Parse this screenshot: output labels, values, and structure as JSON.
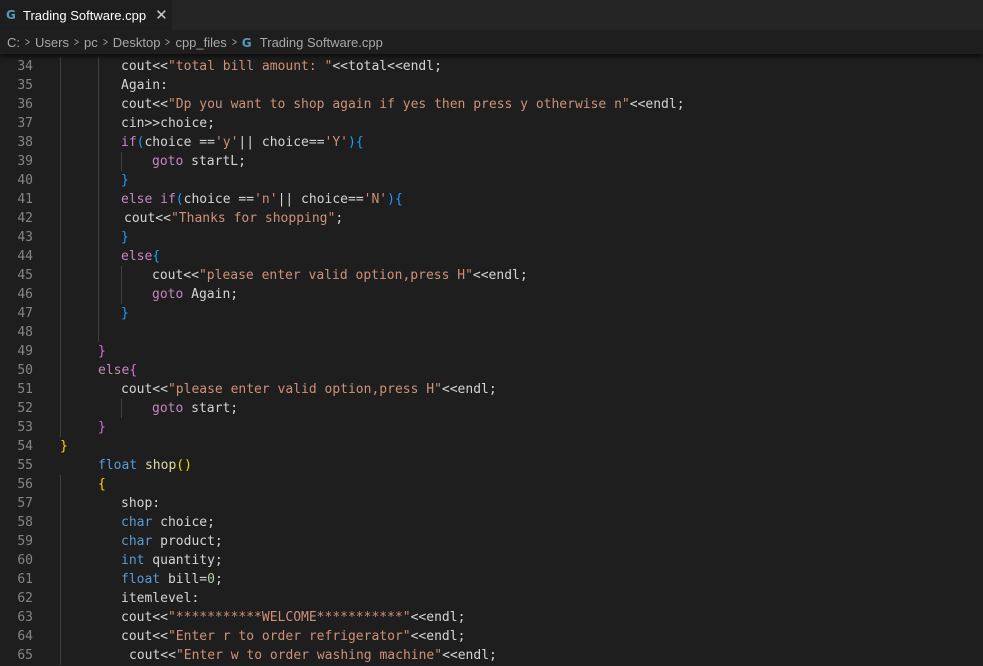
{
  "tab": {
    "label": "Trading Software.cpp",
    "icon": "cpp-file-icon",
    "close_glyph": "✕"
  },
  "breadcrumb": [
    {
      "label": "C:"
    },
    {
      "label": "Users"
    },
    {
      "label": "pc"
    },
    {
      "label": "Desktop"
    },
    {
      "label": "cpp_files"
    },
    {
      "label": "Trading Software.cpp",
      "icon": "cpp-file-icon"
    }
  ],
  "colors": {
    "background": "#1e1e1e",
    "line_number": "#858585",
    "string": "#ce9178",
    "keyword": "#569cd6",
    "control": "#c586c0",
    "function": "#dcdcaa",
    "text": "#d4d4d4",
    "bracket_level1": "#ffd700",
    "bracket_level2": "#da70d6",
    "bracket_level3": "#179fff"
  },
  "code_lines": [
    {
      "num": "34",
      "indent": 3,
      "tokens": [
        [
          "cout<<",
          "plain"
        ],
        [
          "\"total bill amount: \"",
          "str"
        ],
        [
          "<<total<<endl;",
          "plain"
        ]
      ]
    },
    {
      "num": "35",
      "indent": 3,
      "tokens": [
        [
          "Again:",
          "plain"
        ]
      ]
    },
    {
      "num": "36",
      "indent": 3,
      "tokens": [
        [
          "cout<<",
          "plain"
        ],
        [
          "\"Dp you want to shop again if yes then press y otherwise n\"",
          "str"
        ],
        [
          "<<endl;",
          "plain"
        ]
      ]
    },
    {
      "num": "37",
      "indent": 3,
      "tokens": [
        [
          "cin>>choice;",
          "plain"
        ]
      ]
    },
    {
      "num": "38",
      "indent": 3,
      "tokens": [
        [
          "if",
          "ctl"
        ],
        [
          "(",
          "b3"
        ],
        [
          "choice ==",
          "plain"
        ],
        [
          "'y'",
          "str"
        ],
        [
          "|| choice==",
          "plain"
        ],
        [
          "'Y'",
          "str"
        ],
        [
          ")",
          "b3"
        ],
        [
          "{",
          "b3"
        ]
      ]
    },
    {
      "num": "39",
      "indent": 4,
      "tokens": [
        [
          "goto",
          "ctl"
        ],
        [
          " startL;",
          "plain"
        ]
      ]
    },
    {
      "num": "40",
      "indent": 3,
      "tokens": [
        [
          "}",
          "b3"
        ]
      ]
    },
    {
      "num": "41",
      "indent": 3,
      "tokens": [
        [
          "else if",
          "ctl"
        ],
        [
          "(",
          "b3"
        ],
        [
          "choice ==",
          "plain"
        ],
        [
          "'n'",
          "str"
        ],
        [
          "|| choice==",
          "plain"
        ],
        [
          "'N'",
          "str"
        ],
        [
          ")",
          "b3"
        ],
        [
          "{",
          "b3"
        ]
      ]
    },
    {
      "num": "42",
      "indent": 3,
      "extra": 3,
      "tokens": [
        [
          "cout<<",
          "plain"
        ],
        [
          "\"Thanks for shopping\"",
          "str"
        ],
        [
          ";",
          "plain"
        ]
      ]
    },
    {
      "num": "43",
      "indent": 3,
      "tokens": [
        [
          "}",
          "b3"
        ]
      ]
    },
    {
      "num": "44",
      "indent": 3,
      "tokens": [
        [
          "else",
          "ctl"
        ],
        [
          "{",
          "b3"
        ]
      ]
    },
    {
      "num": "45",
      "indent": 4,
      "tokens": [
        [
          "cout<<",
          "plain"
        ],
        [
          "\"please enter valid option,press H\"",
          "str"
        ],
        [
          "<<endl;",
          "plain"
        ]
      ]
    },
    {
      "num": "46",
      "indent": 4,
      "tokens": [
        [
          "goto",
          "ctl"
        ],
        [
          " Again;",
          "plain"
        ]
      ]
    },
    {
      "num": "47",
      "indent": 3,
      "tokens": [
        [
          "}",
          "b3"
        ]
      ]
    },
    {
      "num": "48",
      "indent": 0,
      "tokens": []
    },
    {
      "num": "49",
      "indent": 2,
      "tokens": [
        [
          "}",
          "b2"
        ]
      ]
    },
    {
      "num": "50",
      "indent": 2,
      "tokens": [
        [
          "else",
          "ctl"
        ],
        [
          "{",
          "b2"
        ]
      ]
    },
    {
      "num": "51",
      "indent": 3,
      "tokens": [
        [
          "cout<<",
          "plain"
        ],
        [
          "\"please enter valid option,press H\"",
          "str"
        ],
        [
          "<<endl;",
          "plain"
        ]
      ]
    },
    {
      "num": "52",
      "indent": 4,
      "tokens": [
        [
          "goto",
          "ctl"
        ],
        [
          " start;",
          "plain"
        ]
      ]
    },
    {
      "num": "53",
      "indent": 2,
      "tokens": [
        [
          "}",
          "b2"
        ]
      ]
    },
    {
      "num": "54",
      "indent": 1,
      "tokens": [
        [
          "}",
          "b1"
        ]
      ]
    },
    {
      "num": "55",
      "indent": 2,
      "tokens": [
        [
          "float",
          "kw"
        ],
        [
          " ",
          "plain"
        ],
        [
          "shop",
          "fn"
        ],
        [
          "()",
          "b1"
        ]
      ]
    },
    {
      "num": "56",
      "indent": 2,
      "tokens": [
        [
          "{",
          "b1"
        ]
      ]
    },
    {
      "num": "57",
      "indent": 3,
      "tokens": [
        [
          "shop:",
          "plain"
        ]
      ]
    },
    {
      "num": "58",
      "indent": 3,
      "tokens": [
        [
          "char",
          "kw"
        ],
        [
          " choice;",
          "plain"
        ]
      ]
    },
    {
      "num": "59",
      "indent": 3,
      "tokens": [
        [
          "char",
          "kw"
        ],
        [
          " product;",
          "plain"
        ]
      ]
    },
    {
      "num": "60",
      "indent": 3,
      "tokens": [
        [
          "int",
          "kw"
        ],
        [
          " quantity;",
          "plain"
        ]
      ]
    },
    {
      "num": "61",
      "indent": 3,
      "tokens": [
        [
          "float",
          "kw"
        ],
        [
          " bill=",
          "plain"
        ],
        [
          "0",
          "num"
        ],
        [
          ";",
          "plain"
        ]
      ]
    },
    {
      "num": "62",
      "indent": 3,
      "tokens": [
        [
          "itemlevel:",
          "plain"
        ]
      ]
    },
    {
      "num": "63",
      "indent": 3,
      "tokens": [
        [
          "cout<<",
          "plain"
        ],
        [
          "\"***********WELCOME***********\"",
          "str"
        ],
        [
          "<<endl;",
          "plain"
        ]
      ]
    },
    {
      "num": "64",
      "indent": 3,
      "tokens": [
        [
          "cout<<",
          "plain"
        ],
        [
          "\"Enter r to order refrigerator\"",
          "str"
        ],
        [
          "<<endl;",
          "plain"
        ]
      ]
    },
    {
      "num": "65",
      "indent": 3,
      "extra": 8,
      "tokens": [
        [
          "cout<<",
          "plain"
        ],
        [
          "\"Enter w to order washing machine\"",
          "str"
        ],
        [
          "<<endl;",
          "plain"
        ]
      ]
    }
  ]
}
